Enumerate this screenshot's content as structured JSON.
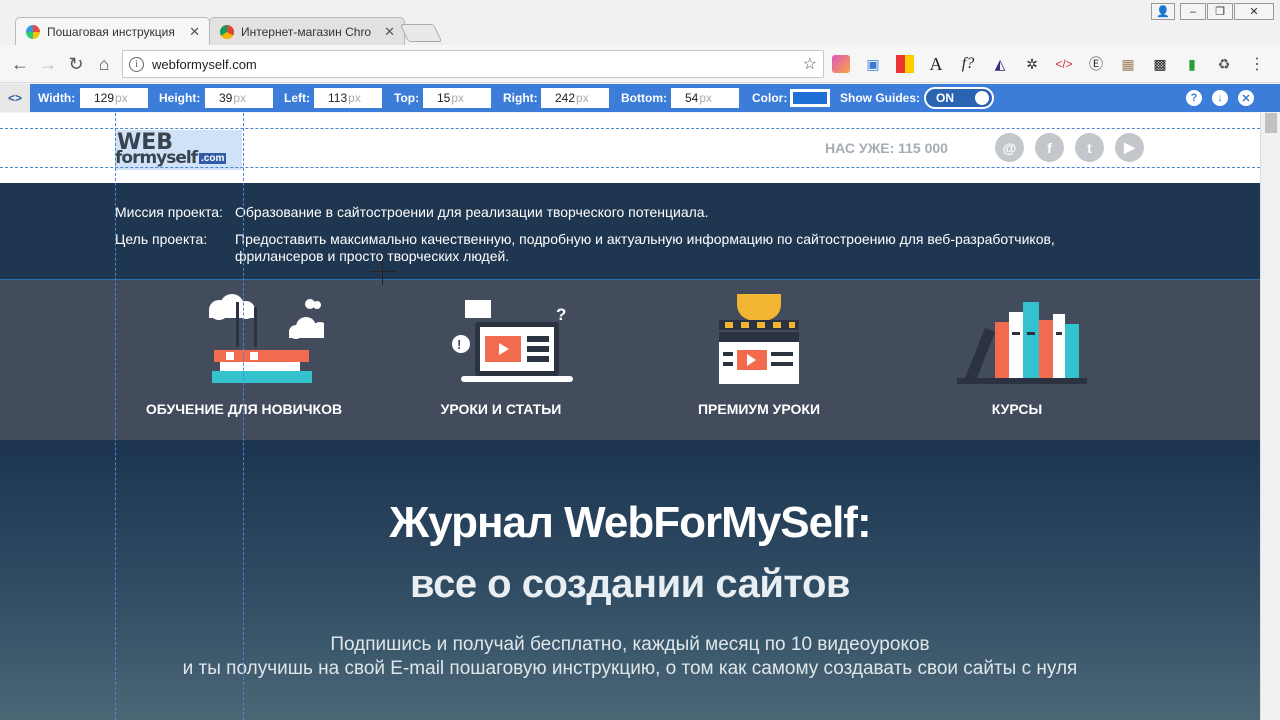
{
  "tabs": [
    {
      "title": "Пошаговая инструкция",
      "active": true
    },
    {
      "title": "Интернет-магазин Chro",
      "active": false
    }
  ],
  "address_bar": {
    "url": "webformyself.com"
  },
  "measure_toolbar": {
    "code_icon": "<>",
    "width_label": "Width:",
    "width_value": "129",
    "height_label": "Height:",
    "height_value": "39",
    "left_label": "Left:",
    "left_value": "113",
    "top_label": "Top:",
    "top_value": "15",
    "right_label": "Right:",
    "right_value": "242",
    "bottom_label": "Bottom:",
    "bottom_value": "54",
    "unit": "px",
    "color_label": "Color:",
    "color_value": "#1f6fd8",
    "guides_label": "Show Guides:",
    "guides_state": "ON"
  },
  "site": {
    "logo": {
      "line1": "WEB",
      "line2": "formyself",
      "suffix": ".com"
    },
    "counter": "НАС УЖЕ: 115 000",
    "social": [
      "email-icon",
      "facebook-icon",
      "twitter-icon",
      "youtube-icon"
    ],
    "mission": {
      "label1": "Миссия проекта:",
      "value1": "Образование в сайтостроении для реализации творческого потенциала.",
      "label2": "Цель проекта:",
      "value2": "Предоставить максимально качественную, подробную и актуальную информацию по сайтостроению для веб-разработчиков, фрилансеров и просто творческих людей."
    },
    "categories": [
      {
        "label": "ОБУЧЕНИЕ ДЛЯ НОВИЧКОВ",
        "icon": "books-cloud-icon"
      },
      {
        "label": "УРОКИ И СТАТЬИ",
        "icon": "laptop-video-icon"
      },
      {
        "label": "ПРЕМИУМ УРОКИ",
        "icon": "trophy-clapper-icon"
      },
      {
        "label": "КУРСЫ",
        "icon": "bookshelf-icon"
      }
    ],
    "hero": {
      "title1": "Журнал WebForMySelf:",
      "title2": "все о создании сайтов",
      "text1": "Подпишись и получай бесплатно, каждый месяц по 10 видеоуроков",
      "text2": "и ты получишь на свой E-mail пошаговую инструкцию, о том как самому создавать свои сайты с нуля"
    }
  },
  "colors": {
    "measure_bar": "#3b7dd8",
    "mission_bg": "#1f3650",
    "categories_bg": "#434c5c",
    "hero_bg": "#1c3450"
  }
}
